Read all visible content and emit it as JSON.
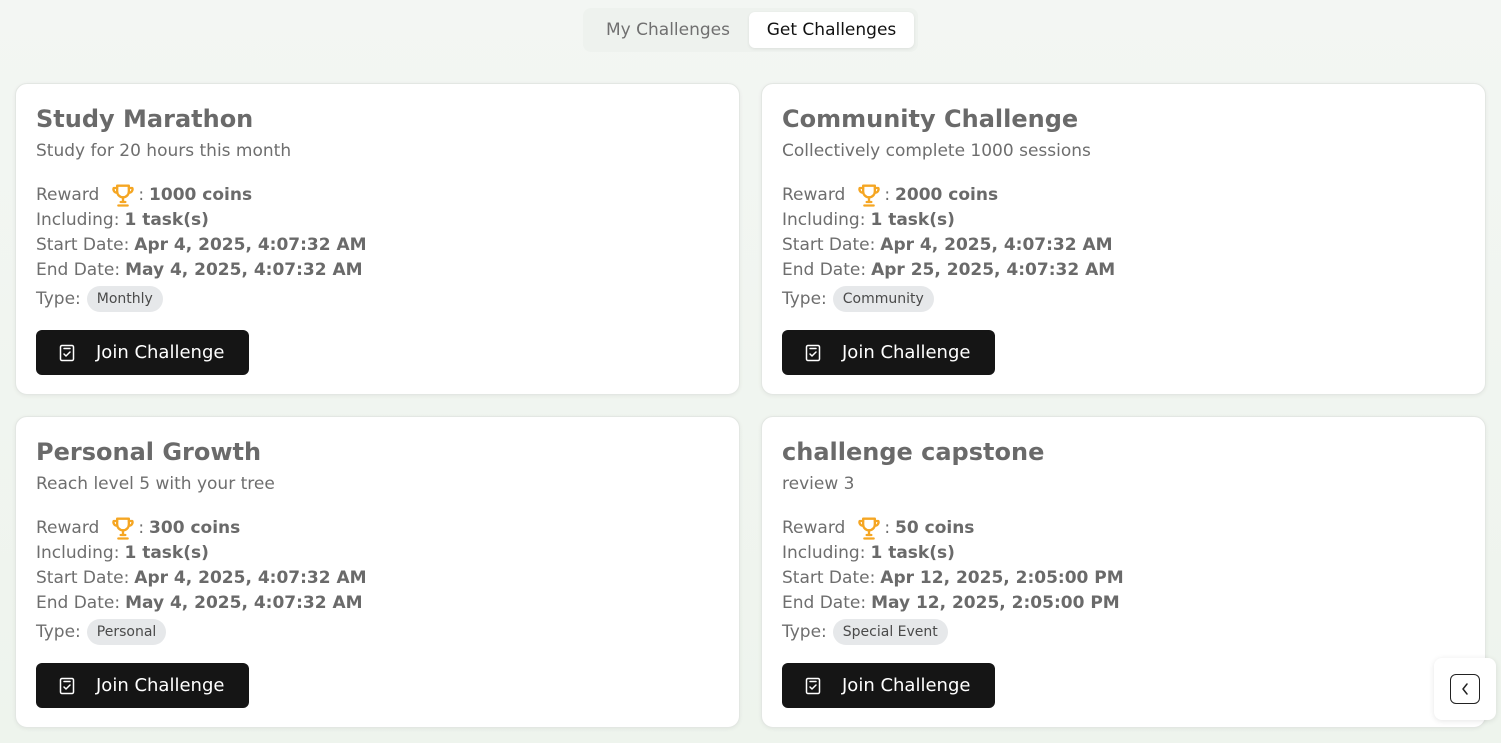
{
  "tabs": {
    "my_label": "My Challenges",
    "get_label": "Get Challenges"
  },
  "labels": {
    "reward": "Reward",
    "colon": ":",
    "including": "Including:",
    "start": "Start Date:",
    "end": "End Date:",
    "type": "Type:",
    "join": "Join Challenge"
  },
  "colors": {
    "trophy": "#f5a623",
    "button": "#151515",
    "badge": "#e6e8ea"
  },
  "challenges": [
    {
      "title": "Study Marathon",
      "description": "Study for 20 hours this month",
      "reward": "1000 coins",
      "tasks": "1 task(s)",
      "start": "Apr 4, 2025, 4:07:32 AM",
      "end": "May 4, 2025, 4:07:32 AM",
      "type": "Monthly"
    },
    {
      "title": "Community Challenge",
      "description": "Collectively complete 1000 sessions",
      "reward": "2000 coins",
      "tasks": "1 task(s)",
      "start": "Apr 4, 2025, 4:07:32 AM",
      "end": "Apr 25, 2025, 4:07:32 AM",
      "type": "Community"
    },
    {
      "title": "Personal Growth",
      "description": "Reach level 5 with your tree",
      "reward": "300 coins",
      "tasks": "1 task(s)",
      "start": "Apr 4, 2025, 4:07:32 AM",
      "end": "May 4, 2025, 4:07:32 AM",
      "type": "Personal"
    },
    {
      "title": "challenge capstone",
      "description": "review 3",
      "reward": "50 coins",
      "tasks": "1 task(s)",
      "start": "Apr 12, 2025, 2:05:00 PM",
      "end": "May 12, 2025, 2:05:00 PM",
      "type": "Special Event"
    }
  ],
  "icons": {
    "trophy": "trophy-icon",
    "join": "clipboard-check-icon",
    "collapse": "chevron-left-icon"
  }
}
